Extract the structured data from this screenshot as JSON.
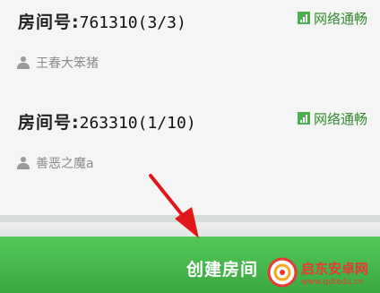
{
  "rooms": [
    {
      "label": "房间号:",
      "number": "761310(3/3)",
      "network": "网络通畅",
      "owner": "王春大笨猪"
    },
    {
      "label": "房间号:",
      "number": "263310(1/10)",
      "network": "网络通畅",
      "owner": "善恶之魔a"
    }
  ],
  "create_button": {
    "label": "创建房间"
  },
  "watermark": {
    "name": "启东安卓网",
    "url": "www.qdtedu.cn"
  },
  "colors": {
    "accent_green": "#3aa840",
    "network_green": "#2e8b2e",
    "arrow_red": "#e0161a"
  },
  "icons": {
    "network": "signal-icon",
    "owner": "person-icon",
    "pointer": "arrow-icon"
  }
}
